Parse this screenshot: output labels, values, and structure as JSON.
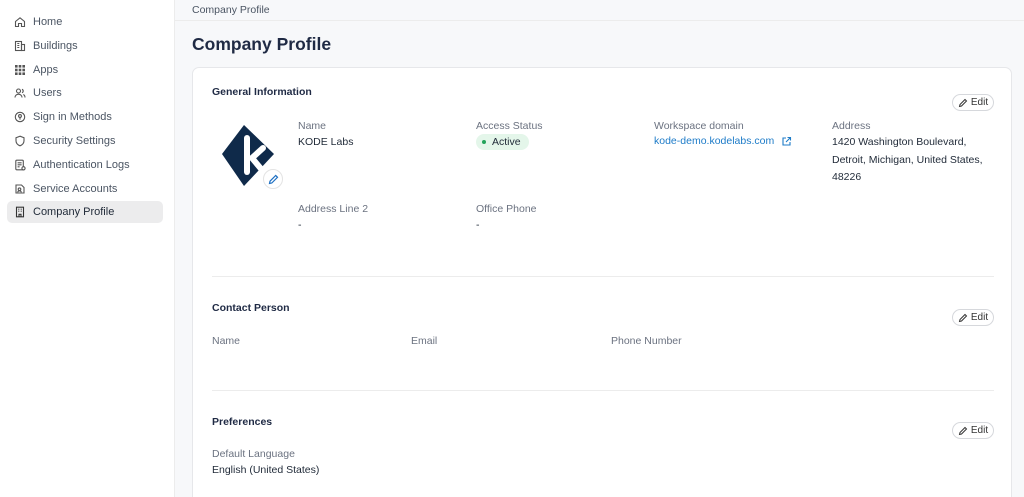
{
  "sidebar": {
    "items": [
      {
        "label": "Home",
        "icon": "home-icon"
      },
      {
        "label": "Buildings",
        "icon": "building-icon"
      },
      {
        "label": "Apps",
        "icon": "grid-icon"
      },
      {
        "label": "Users",
        "icon": "users-icon"
      },
      {
        "label": "Sign in Methods",
        "icon": "signin-icon"
      },
      {
        "label": "Security Settings",
        "icon": "shield-icon"
      },
      {
        "label": "Authentication Logs",
        "icon": "log-icon"
      },
      {
        "label": "Service Accounts",
        "icon": "service-icon"
      },
      {
        "label": "Company Profile",
        "icon": "company-icon"
      }
    ],
    "active_index": 8
  },
  "breadcrumb": "Company Profile",
  "page_title": "Company Profile",
  "general": {
    "title": "General Information",
    "edit_label": "Edit",
    "name_label": "Name",
    "name_value": "KODE Labs",
    "access_label": "Access Status",
    "access_value": "Active",
    "domain_label": "Workspace domain",
    "domain_value": "kode-demo.kodelabs.com",
    "address_label": "Address",
    "address_lines": [
      "1420 Washington Boulevard,",
      "Detroit, Michigan, United States,",
      "48226"
    ],
    "address2_label": "Address Line 2",
    "address2_value": "-",
    "phone_label": "Office Phone",
    "phone_value": "-"
  },
  "contact": {
    "title": "Contact Person",
    "edit_label": "Edit",
    "name_label": "Name",
    "email_label": "Email",
    "phone_label": "Phone Number"
  },
  "preferences": {
    "title": "Preferences",
    "edit_label": "Edit",
    "language_label": "Default Language",
    "language_value": "English (United States)"
  },
  "colors": {
    "logo": "#0f2a4a",
    "active_bg": "#e4f6ea",
    "active_dot": "#22a35a",
    "link": "#1d7bc8"
  }
}
